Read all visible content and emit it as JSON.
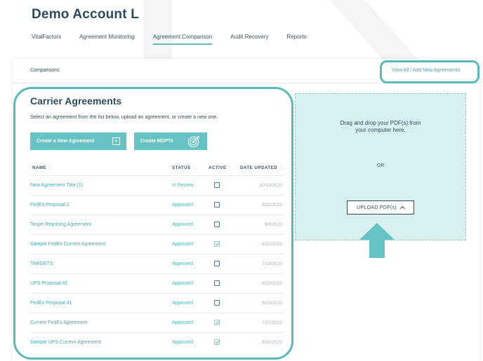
{
  "account": {
    "title": "Demo Account L"
  },
  "nav": {
    "tabs": [
      {
        "label": "VitalFactors"
      },
      {
        "label": "Agreement Monitoring"
      },
      {
        "label": "Agreement Comparison"
      },
      {
        "label": "Audit Recovery"
      },
      {
        "label": "Reports"
      }
    ],
    "active": "Agreement Comparison"
  },
  "breadcrumb": "Comparisons",
  "view_all_link": "View All / Add New Agreements",
  "carrier": {
    "title": "Carrier Agreements",
    "subtitle": "Select an agreement from the list below, upload an agreement, or create a new one.",
    "create_new_label": "Create a New Agreement",
    "create_mdpts_label": "Create MDPTs"
  },
  "table": {
    "headers": {
      "name": "NAME",
      "status": "STATUS",
      "active": "ACTIVE",
      "date": "DATE UPDATED"
    },
    "sort_glyph": "↑↓",
    "rows": [
      {
        "name": "New Agreement Title (1)",
        "status": "In Review",
        "active": false,
        "date": "10/13/2023"
      },
      {
        "name": "FedEx Proposal 2",
        "status": "Approved",
        "active": false,
        "date": "9/21/2023"
      },
      {
        "name": "Target Repricing Agreement",
        "status": "Approved",
        "active": false,
        "date": "9/8/2023"
      },
      {
        "name": "Sample FedEx Current Agreement",
        "status": "Approved",
        "active": true,
        "date": "6/10/2023"
      },
      {
        "name": "TARGETS",
        "status": "Approved",
        "active": false,
        "date": "7/13/2023"
      },
      {
        "name": "UPS Proposal #1",
        "status": "Approved",
        "active": false,
        "date": "6/23/2023"
      },
      {
        "name": "FedEx Proposal #1",
        "status": "Approved",
        "active": false,
        "date": "6/23/2023"
      },
      {
        "name": "Current FedEx Agreement",
        "status": "Approved",
        "active": true,
        "date": "7/27/2023"
      },
      {
        "name": "Sample UPS Current Agreement",
        "status": "Approved",
        "active": true,
        "date": "6/10/2023"
      }
    ]
  },
  "upload": {
    "drop_line1": "Drag and drop your PDF(s) from",
    "drop_line2": "your computer here.",
    "or": "OR",
    "button_label": "UPLOAD PDF(s)"
  },
  "colors": {
    "accent": "#5ab9bb",
    "button": "#66c3c3",
    "title": "#2b4a5e",
    "link": "#3fa9b5",
    "dropzone": "#d9f0f0"
  }
}
